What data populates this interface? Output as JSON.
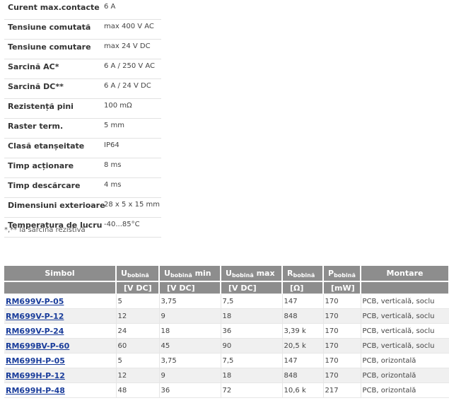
{
  "specs": [
    {
      "label": "Curent max.contacte",
      "value": "6 A"
    },
    {
      "label": "Tensiune comutată",
      "value": "max 400 V AC"
    },
    {
      "label": "Tensiune comutare",
      "value": "max 24 V DC"
    },
    {
      "label": "Sarcină AC*",
      "value": "6 A / 250 V AC"
    },
    {
      "label": "Sarcină DC**",
      "value": "6 A / 24 V DC"
    },
    {
      "label": "Rezistență pini",
      "value": "100 mΩ"
    },
    {
      "label": "Raster term.",
      "value": "5 mm"
    },
    {
      "label": "Clasă etanșeitate",
      "value": "IP64"
    },
    {
      "label": "Timp acționare",
      "value": "8 ms"
    },
    {
      "label": "Timp descărcare",
      "value": "4 ms"
    },
    {
      "label": "Dimensiuni exterioare",
      "value": "28 x 5 x 15 mm"
    },
    {
      "label": "Temperatura de lucru",
      "value": "-40...85°C"
    }
  ],
  "note": "*,** la sarcina rezistivă",
  "table": {
    "headers": {
      "symbol": "Simbol",
      "u_coil": {
        "main": "U",
        "sub": "bobină"
      },
      "u_min": {
        "main": "U",
        "sub": "bobină",
        "suffix": " min"
      },
      "u_max": {
        "main": "U",
        "sub": "bobină",
        "suffix": " max"
      },
      "r_coil": {
        "main": "R",
        "sub": "bobină"
      },
      "p_coil": {
        "main": "P",
        "sub": "bobină"
      },
      "mount": "Montare"
    },
    "units": [
      "",
      "[V DC]",
      "[V DC]",
      "[V DC]",
      "[Ω]",
      "[mW]",
      ""
    ],
    "rows": [
      {
        "symbol": "RM699V-P-05",
        "u": "5",
        "umin": "3,75",
        "umax": "7,5",
        "r": "147",
        "p": "170",
        "mount": "PCB, verticală, soclu"
      },
      {
        "symbol": "RM699V-P-12",
        "u": "12",
        "umin": "9",
        "umax": "18",
        "r": "848",
        "p": "170",
        "mount": "PCB, verticală, soclu"
      },
      {
        "symbol": "RM699V-P-24",
        "u": "24",
        "umin": "18",
        "umax": "36",
        "r": "3,39 k",
        "p": "170",
        "mount": "PCB, verticală, soclu"
      },
      {
        "symbol": "RM699BV-P-60",
        "u": "60",
        "umin": "45",
        "umax": "90",
        "r": "20,5 k",
        "p": "170",
        "mount": "PCB, verticală, soclu"
      },
      {
        "symbol": "RM699H-P-05",
        "u": "5",
        "umin": "3,75",
        "umax": "7,5",
        "r": "147",
        "p": "170",
        "mount": "PCB, orizontală"
      },
      {
        "symbol": "RM699H-P-12",
        "u": "12",
        "umin": "9",
        "umax": "18",
        "r": "848",
        "p": "170",
        "mount": "PCB, orizontală"
      },
      {
        "symbol": "RM699H-P-48",
        "u": "48",
        "umin": "36",
        "umax": "72",
        "r": "10,6 k",
        "p": "217",
        "mount": "PCB, orizontală"
      }
    ]
  }
}
